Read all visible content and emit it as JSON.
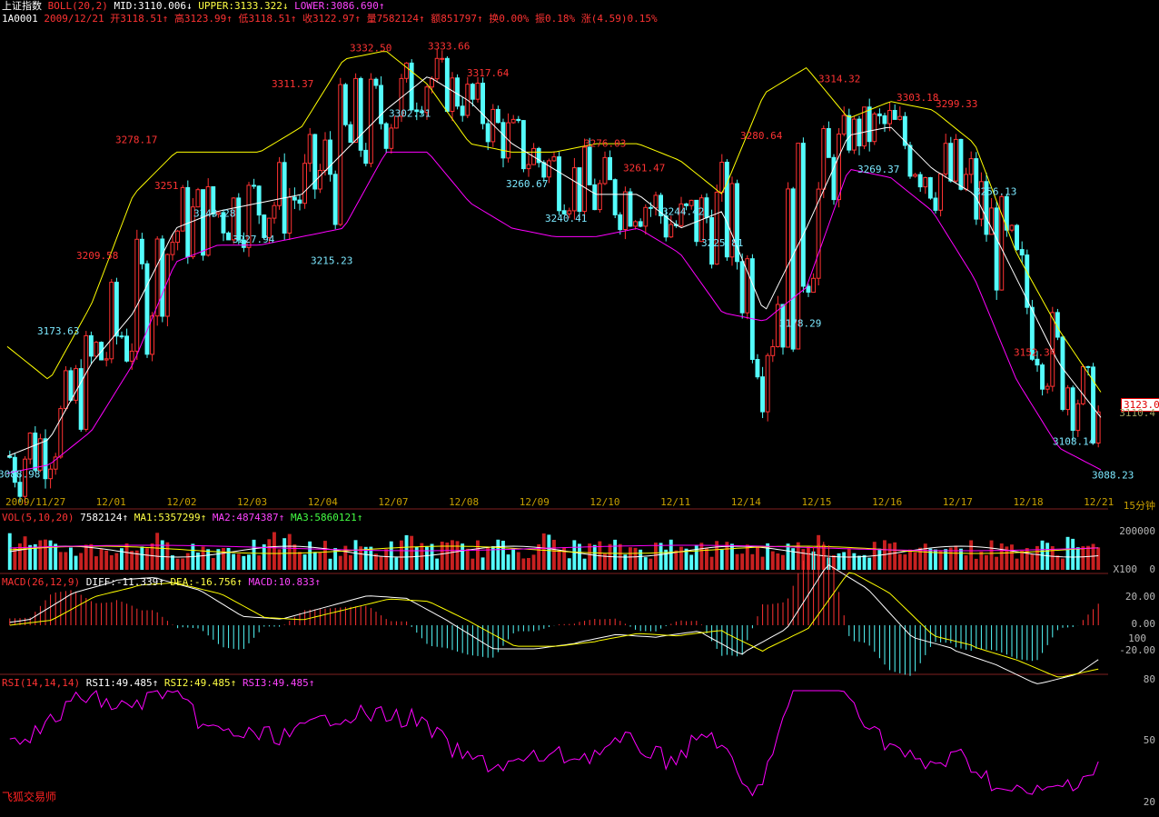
{
  "header": {
    "name": "上证指数",
    "boll_label": "BOLL(20,2)",
    "mid": "MID:3110.006↓",
    "upper": "UPPER:3133.322↓",
    "lower": "LOWER:3086.690↑"
  },
  "quote": {
    "code": "1A0001",
    "date": "2009/12/21",
    "open": "开3118.51↑",
    "high": "高3123.99↑",
    "low": "低3118.51↑",
    "close": "收3122.97↑",
    "vol": "量7582124↑",
    "amount": "额851797↑",
    "turnover": "换0.00%",
    "amplitude": "振0.18%",
    "change": "涨(4.59)0.15%"
  },
  "price_tag": "3123.0",
  "price_sub": "3110.4",
  "dates": [
    "2009/11/27",
    "12/01",
    "12/02",
    "12/03",
    "12/04",
    "12/07",
    "12/08",
    "12/09",
    "12/10",
    "12/11",
    "12/14",
    "12/15",
    "12/16",
    "12/17",
    "12/18",
    "12/21"
  ],
  "period": "15分钟",
  "vol_panel": {
    "label": "VOL(5,10,20)",
    "v": "7582124↑",
    "ma1": "MA1:5357299↑",
    "ma2": "MA2:4874387↑",
    "ma3": "MA3:5860121↑",
    "axis_top": "200000",
    "axis_bottom_unit": "X100",
    "axis_bottom": "0"
  },
  "macd_panel": {
    "label": "MACD(26,12,9)",
    "diff": "DIFF:-11.339↑",
    "dea": "DEA:-16.756↑",
    "macd": "MACD:10.833↑",
    "axis": [
      "20.00",
      "0.00",
      "100",
      "-20.00"
    ]
  },
  "rsi_panel": {
    "label": "RSI(14,14,14)",
    "rsi1": "RSI1:49.485↑",
    "rsi2": "RSI2:49.485↑",
    "rsi3": "RSI3:49.485↑",
    "axis": [
      "80",
      "50",
      "20"
    ]
  },
  "brand": "飞狐交易师",
  "colors": {
    "up": "#ff3232",
    "down": "#54fcfc",
    "mid": "#ffffff",
    "upper": "#ffff00",
    "lower": "#ff00ff",
    "bg": "#000000"
  },
  "chart_data": {
    "type": "line",
    "series": [
      {
        "name": "MID",
        "values": [
          3095,
          3105,
          3150,
          3180,
          3230,
          3240,
          3245,
          3250,
          3275,
          3300,
          3320,
          3305,
          3280,
          3265,
          3250,
          3250,
          3230,
          3240,
          3180,
          3230,
          3285,
          3290,
          3265,
          3250,
          3200,
          3150,
          3118
        ]
      },
      {
        "name": "UPPER",
        "values": [
          3160,
          3140,
          3185,
          3250,
          3275,
          3275,
          3275,
          3290,
          3330,
          3335,
          3315,
          3280,
          3275,
          3275,
          3280,
          3280,
          3270,
          3250,
          3310,
          3325,
          3295,
          3305,
          3300,
          3280,
          3215,
          3170,
          3133
        ]
      },
      {
        "name": "LOWER",
        "values": [
          3085,
          3090,
          3110,
          3150,
          3210,
          3220,
          3220,
          3225,
          3230,
          3275,
          3275,
          3245,
          3230,
          3225,
          3225,
          3230,
          3215,
          3180,
          3175,
          3195,
          3265,
          3260,
          3240,
          3200,
          3140,
          3100,
          3087
        ]
      }
    ],
    "annotations": [
      {
        "label": "3088.98",
        "color": "cyan"
      },
      {
        "label": "3173.63",
        "color": "cyan"
      },
      {
        "label": "3209.58",
        "color": "red"
      },
      {
        "label": "3278.17",
        "color": "red"
      },
      {
        "label": "3251",
        "color": "red"
      },
      {
        "label": "3243.28",
        "color": "cyan"
      },
      {
        "label": "3227.94",
        "color": "cyan"
      },
      {
        "label": "3311.37",
        "color": "red"
      },
      {
        "label": "3215.23",
        "color": "cyan"
      },
      {
        "label": "3332.50",
        "color": "red"
      },
      {
        "label": "3302.31",
        "color": "cyan"
      },
      {
        "label": "3333.66",
        "color": "red"
      },
      {
        "label": "3317.64",
        "color": "red"
      },
      {
        "label": "3260.67",
        "color": "cyan"
      },
      {
        "label": "3240.41",
        "color": "cyan"
      },
      {
        "label": "3276.03",
        "color": "red"
      },
      {
        "label": "3261.47",
        "color": "red"
      },
      {
        "label": "3244.42",
        "color": "cyan"
      },
      {
        "label": "3225.81",
        "color": "cyan"
      },
      {
        "label": "3280.64",
        "color": "red"
      },
      {
        "label": "3178.29",
        "color": "cyan"
      },
      {
        "label": "3314.32",
        "color": "red"
      },
      {
        "label": "3269.37",
        "color": "cyan"
      },
      {
        "label": "3303.18",
        "color": "red"
      },
      {
        "label": "3299.33",
        "color": "red"
      },
      {
        "label": "3256.13",
        "color": "cyan"
      },
      {
        "label": "3152.34",
        "color": "red"
      },
      {
        "label": "3108.14",
        "color": "cyan"
      },
      {
        "label": "3088.23",
        "color": "cyan"
      }
    ]
  }
}
